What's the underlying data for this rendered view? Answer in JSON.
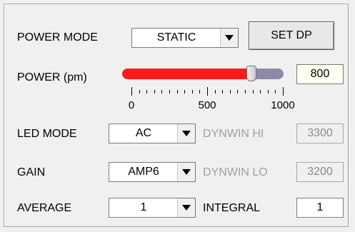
{
  "power_mode": {
    "label": "POWER MODE",
    "value": "STATIC",
    "set_dp_label": "SET DP"
  },
  "power": {
    "label": "POWER (pm)",
    "value": "800",
    "slider_fraction": 0.8,
    "scale_labels": [
      "0",
      "500",
      "1000"
    ],
    "fill_color": "#ff1a1a",
    "track_color": "#8b8ba6"
  },
  "led_mode": {
    "label": "LED MODE",
    "value": "AC"
  },
  "dynwin_hi": {
    "label": "DYNWIN HI",
    "value": "3300"
  },
  "gain": {
    "label": "GAIN",
    "value": "AMP6"
  },
  "dynwin_lo": {
    "label": "DYNWIN LO",
    "value": "3200"
  },
  "average": {
    "label": "AVERAGE",
    "value": "1"
  },
  "integral": {
    "label": "INTEGRAL",
    "value": "1"
  },
  "icons": {
    "dropdown": "chevron-down-icon"
  }
}
